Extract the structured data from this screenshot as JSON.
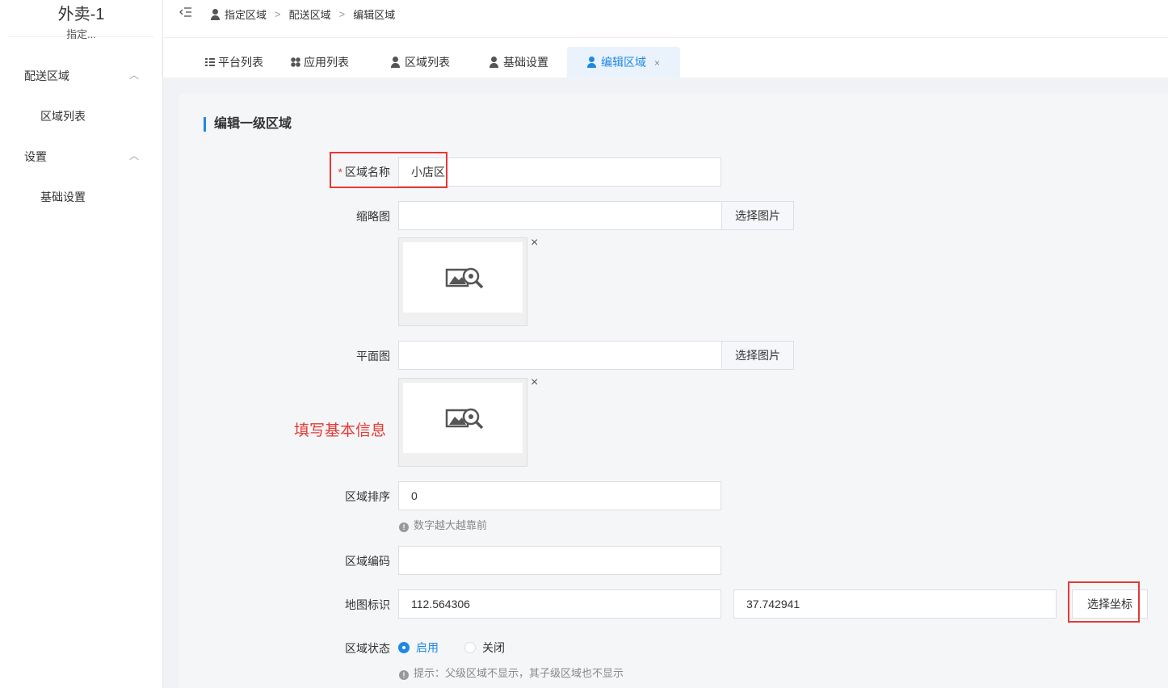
{
  "sidebar": {
    "brand_title": "外卖-1",
    "brand_subtitle": "指定...",
    "groups": [
      {
        "label": "配送区域",
        "items": [
          "区域列表"
        ]
      },
      {
        "label": "设置",
        "items": [
          "基础设置"
        ]
      }
    ]
  },
  "breadcrumb": [
    "指定区域",
    "配送区域",
    "编辑区域"
  ],
  "tabs": [
    {
      "label": "平台列表",
      "icon": "list-icon"
    },
    {
      "label": "应用列表",
      "icon": "grid-icon"
    },
    {
      "label": "区域列表",
      "icon": "user-icon"
    },
    {
      "label": "基础设置",
      "icon": "user-icon"
    },
    {
      "label": "编辑区域",
      "icon": "user-icon",
      "active": true
    }
  ],
  "form": {
    "title": "编辑一级区域",
    "name_label": "区域名称",
    "name_value": "小店区",
    "thumbnail_label": "缩略图",
    "plan_label": "平面图",
    "select_image": "选择图片",
    "sort_label": "区域排序",
    "sort_value": "0",
    "sort_help": "数字越大越靠前",
    "code_label": "区域编码",
    "code_value": "",
    "map_label": "地图标识",
    "lng_value": "112.564306",
    "lat_value": "37.742941",
    "select_coord": "选择坐标",
    "status_label": "区域状态",
    "status_on": "启用",
    "status_off": "关闭",
    "status_help": "提示：父级区域不显示，其子级区域也不显示"
  },
  "annotation": "填写基本信息",
  "colors": {
    "accent": "#1e88e5",
    "annotation": "#e53935"
  }
}
